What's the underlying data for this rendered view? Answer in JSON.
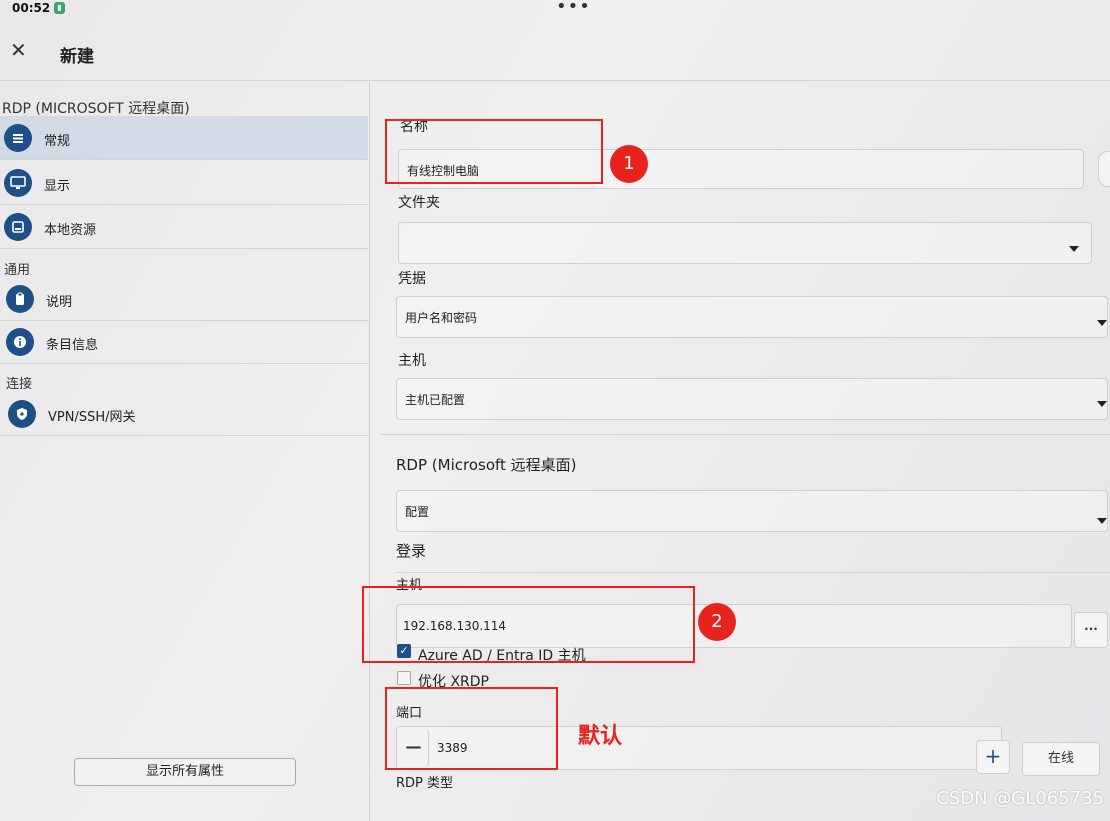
{
  "status": {
    "time": "00:52"
  },
  "header": {
    "title": "新建"
  },
  "sidebar": {
    "rdp_section": "RDP (MICROSOFT 远程桌面)",
    "general_section": "通用",
    "connect_section": "连接",
    "items": [
      {
        "label": "常规",
        "icon": "list-icon"
      },
      {
        "label": "显示",
        "icon": "monitor-icon"
      },
      {
        "label": "本地资源",
        "icon": "drive-icon"
      },
      {
        "label": "说明",
        "icon": "clipboard-icon"
      },
      {
        "label": "条目信息",
        "icon": "info-icon"
      },
      {
        "label": "VPN/SSH/网关",
        "icon": "shield-icon"
      }
    ],
    "show_all_label": "显示所有属性"
  },
  "form": {
    "name_label": "名称",
    "name_value": "有线控制电脑",
    "folder_label": "文件夹",
    "folder_value": "",
    "credentials_label": "凭据",
    "credentials_value": "用户名和密码",
    "host_label": "主机",
    "host_value": "主机已配置",
    "rdp_heading": "RDP (Microsoft 远程桌面)",
    "config_value": "配置",
    "login_heading": "登录",
    "host2_label": "主机",
    "host2_value": "192.168.130.114",
    "azure_label": "Azure AD / Entra ID 主机",
    "azure_checked": true,
    "xrdp_label": "优化 XRDP",
    "xrdp_checked": false,
    "port_label": "端口",
    "port_value": "3389",
    "minus_label": "—",
    "plus_label": "+",
    "online_label": "在线",
    "more_label": "···",
    "rdp_type_label": "RDP 类型"
  },
  "annotations": {
    "circle1": "1",
    "circle2": "2",
    "default_text": "默认"
  },
  "watermark": "CSDN @GL065735",
  "colors": {
    "accent": "#1e4f86",
    "annotation": "#e8231e"
  }
}
